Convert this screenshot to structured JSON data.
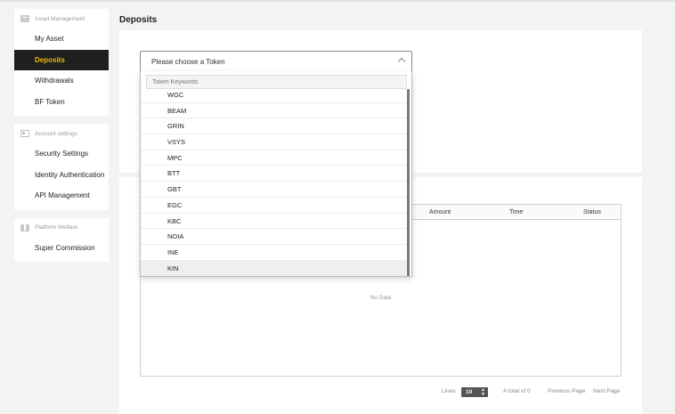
{
  "sidebar": {
    "groups": [
      {
        "title": "Asset Management",
        "icon": "wallet-icon",
        "items": [
          {
            "label": "My Asset"
          },
          {
            "label": "Deposits",
            "active": true
          },
          {
            "label": "Withdrawals"
          },
          {
            "label": "BF Token"
          }
        ]
      },
      {
        "title": "Account settings",
        "icon": "id-card-icon",
        "items": [
          {
            "label": "Security Settings"
          },
          {
            "label": "Identity Authentication"
          },
          {
            "label": "API Management"
          }
        ]
      },
      {
        "title": "Platform Welfare",
        "icon": "gift-icon",
        "items": [
          {
            "label": "Super Commission"
          }
        ]
      }
    ]
  },
  "page": {
    "title": "Deposits"
  },
  "token_select": {
    "placeholder": "Please choose a Token",
    "search_placeholder": "Token Keywords",
    "options": [
      "WGC",
      "BEAM",
      "GRIN",
      "VSYS",
      "MPC",
      "BTT",
      "GBT",
      "EGC",
      "KBC",
      "NOIA",
      "INE",
      "KIN"
    ],
    "hovered": "KIN"
  },
  "table": {
    "columns": [
      "Amount",
      "Time",
      "Status"
    ],
    "empty_text": "No Data"
  },
  "pagination": {
    "lines_label": "Lines",
    "lines_value": "10",
    "total_text": "A total of 0",
    "prev_label": "Previous Page",
    "next_label": "Next Page"
  },
  "colors": {
    "accent": "#f0b90b",
    "active_bg": "#1f1f1f"
  }
}
